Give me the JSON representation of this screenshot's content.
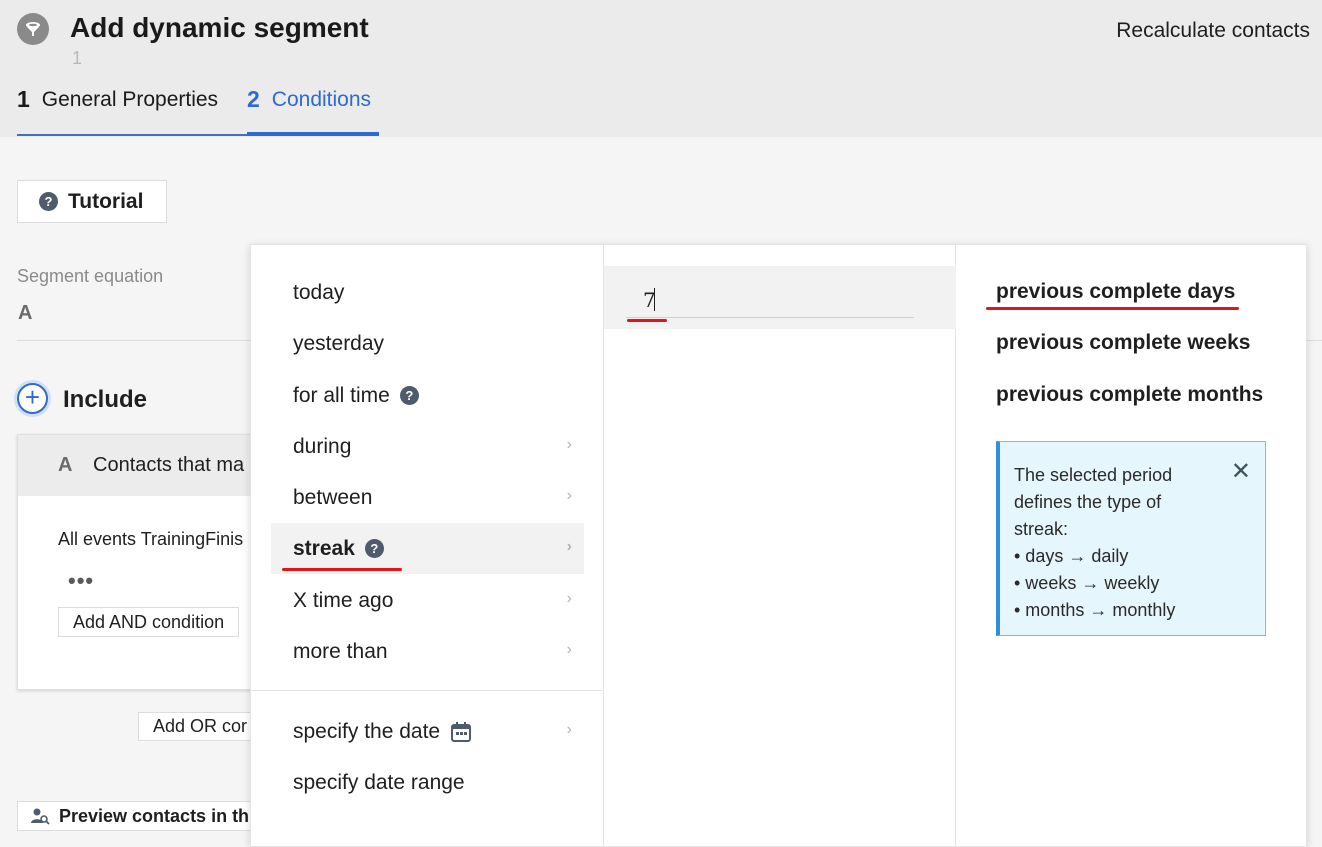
{
  "header": {
    "title": "Add dynamic segment",
    "subtitle": "1",
    "recalculate_label": "Recalculate contacts",
    "tabs": [
      {
        "num": "1",
        "label": "General Properties"
      },
      {
        "num": "2",
        "label": "Conditions"
      }
    ]
  },
  "main": {
    "tutorial_label": "Tutorial",
    "equation_label": "Segment equation",
    "equation_value": "A",
    "include_label": "Include",
    "card": {
      "letter": "A",
      "title": "Contacts that ma",
      "events": "All events TrainingFinis",
      "dots": "•••",
      "add_and_label": "Add AND condition"
    },
    "add_or_label": "Add OR cor",
    "preview_label": "Preview contacts in th"
  },
  "dropdown": {
    "options": [
      {
        "label": "today"
      },
      {
        "label": "yesterday"
      },
      {
        "label": "for all time"
      },
      {
        "label": "during"
      },
      {
        "label": "between"
      },
      {
        "label": "streak"
      },
      {
        "label": "X time ago"
      },
      {
        "label": "more than"
      },
      {
        "label": "specify the date"
      },
      {
        "label": "specify date range"
      }
    ],
    "selected": "streak",
    "number_value": "7",
    "periods": [
      "previous complete days",
      "previous complete weeks",
      "previous complete months"
    ],
    "selected_period": "previous complete days",
    "info": {
      "lines": [
        "The selected period defines the type of streak:",
        "• days → daily",
        "• weeks → weekly",
        "• months → monthly"
      ],
      "close_glyph": "✕"
    }
  },
  "colors": {
    "accent": "#2f6ad0",
    "highlight_red": "#e0161c",
    "info_bg": "#e6f6fd",
    "info_border": "#2f90d9"
  }
}
